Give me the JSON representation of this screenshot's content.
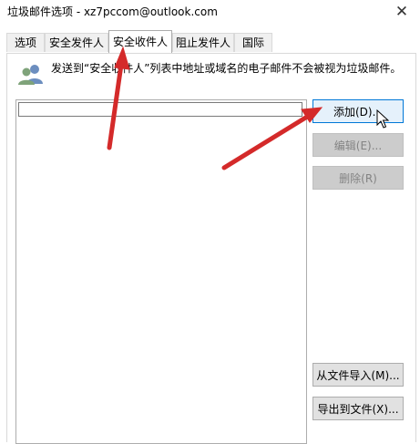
{
  "window": {
    "title": "垃圾邮件选项 - xz7pccom@outlook.com",
    "close_symbol": "✕"
  },
  "tabs": [
    {
      "label": "选项"
    },
    {
      "label": "安全发件人"
    },
    {
      "label": "安全收件人",
      "active": true
    },
    {
      "label": "阻止发件人"
    },
    {
      "label": "国际"
    }
  ],
  "panel": {
    "icon": "users-icon",
    "description": "发送到“安全收件人”列表中地址或域名的电子邮件不会被视为垃圾邮件。",
    "list_edit_value": ""
  },
  "buttons": {
    "add": "添加(D)...",
    "edit": "编辑(E)...",
    "remove": "删除(R)",
    "import": "从文件导入(M)...",
    "export": "导出到文件(X)..."
  },
  "colors": {
    "annotation_arrow": "#d42a2a",
    "focus_border": "#0078d7",
    "icon_blue": "#6c8ebf",
    "icon_green": "#7fa37a"
  }
}
